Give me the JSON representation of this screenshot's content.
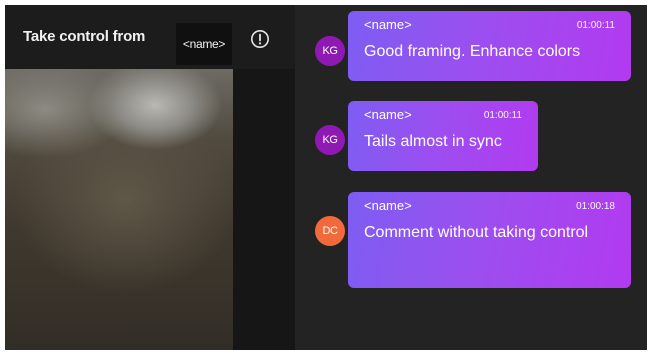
{
  "header": {
    "title": "Take control from",
    "name": "<name>"
  },
  "messages": [
    {
      "initials": "KG",
      "avatar_color": "#8f1ab3",
      "name": "<name>",
      "time": "01:00:11",
      "text": "Good framing. Enhance colors"
    },
    {
      "initials": "KG",
      "avatar_color": "#8f1ab3",
      "name": "<name>",
      "time": "01:00:11",
      "text": "Tails almost in sync"
    },
    {
      "initials": "DC",
      "avatar_color": "#f26a3c",
      "name": "<name>",
      "time": "01:00:18",
      "text": "Comment without taking control"
    }
  ],
  "colors": {
    "bubble_gradient_start": "#7d5df2",
    "bubble_gradient_end": "#b23af0",
    "panel_background": "#232323"
  }
}
